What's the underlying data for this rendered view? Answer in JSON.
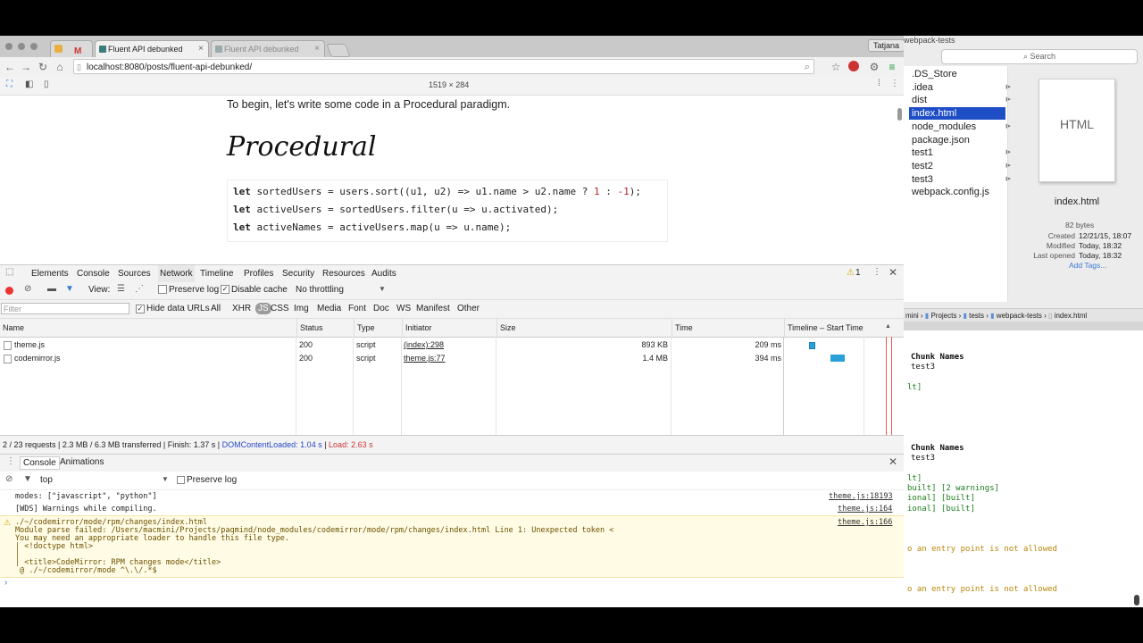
{
  "browser": {
    "tabs": [
      {
        "label": ""
      },
      {
        "label": "Fluent API debunked"
      },
      {
        "label": "Fluent API debunked"
      }
    ],
    "profile": "Tatjana",
    "url": "localhost:8080/posts/fluent-api-debunked/",
    "viewport_size": "1519 × 284"
  },
  "article": {
    "intro": "To begin, let's write some code in a Procedural paradigm.",
    "heading": "Procedural",
    "code": [
      {
        "kw": "let",
        "rest_a": " sortedUsers = users.sort((u1, u2) => u1.name > u2.name ? ",
        "n1": "1",
        "mid": " : ",
        "n2": "-1",
        "end": ");"
      },
      {
        "kw": "let",
        "rest": " activeUsers = sortedUsers.filter(u => u.activated);"
      },
      {
        "kw": "let",
        "rest": " activeNames = activeUsers.map(u => u.name);"
      }
    ]
  },
  "devtools": {
    "tabs": [
      "Elements",
      "Console",
      "Sources",
      "Network",
      "Timeline",
      "Profiles",
      "Security",
      "Resources",
      "Audits"
    ],
    "active_tab": "Network",
    "warning_count": "1",
    "network": {
      "view_label": "View:",
      "preserve_log": "Preserve log",
      "disable_cache": "Disable cache",
      "throttling": "No throttling",
      "filter_placeholder": "Filter",
      "hide_data_urls": "Hide data URLs",
      "types": [
        "All",
        "XHR",
        "JS",
        "CSS",
        "Img",
        "Media",
        "Font",
        "Doc",
        "WS",
        "Manifest",
        "Other"
      ],
      "active_type": "JS",
      "columns": [
        "Name",
        "Status",
        "Type",
        "Initiator",
        "Size",
        "Time",
        "Timeline – Start Time"
      ],
      "rows": [
        {
          "name": "theme.js",
          "status": "200",
          "type": "script",
          "initiator": "(index):298",
          "size": "893 KB",
          "time": "209 ms"
        },
        {
          "name": "codemirror.js",
          "status": "200",
          "type": "script",
          "initiator": "theme.js:77",
          "size": "1.4 MB",
          "time": "394 ms"
        }
      ],
      "summary": "2 / 23 requests | 2.3 MB / 6.3 MB transferred | Finish: 1.37 s | ",
      "domcontentloaded": "DOMContentLoaded: 1.04 s",
      "sep": " | ",
      "load": "Load: 2.63 s"
    },
    "drawer": {
      "tabs": [
        "Console",
        "Animations"
      ],
      "context": "top",
      "preserve_log": "Preserve log",
      "lines": [
        {
          "text": "modes: [\"javascript\", \"python\"]",
          "src": "theme.js:18193"
        },
        {
          "text": "[WDS] Warnings while compiling.",
          "src": "theme.js:164"
        }
      ],
      "warning": {
        "src": "theme.js:166",
        "lines": [
          "./~/codemirror/mode/rpm/changes/index.html",
          "Module parse failed: /Users/macmini/Projects/paqmind/node_modules/codemirror/mode/rpm/changes/index.html Line 1: Unexpected token <",
          "You may need an appropriate loader to handle this file type.",
          "| <!doctype html>",
          "|",
          "| <title>CodeMirror: RPM changes mode</title>",
          " @ ./~/codemirror/mode ^\\.\\/.*$"
        ]
      },
      "prompt": "›"
    }
  },
  "finder": {
    "title": "webpack-tests",
    "search_placeholder": "Search",
    "items": [
      {
        "label": ".DS_Store",
        "folder": false
      },
      {
        "label": ".idea",
        "folder": true
      },
      {
        "label": "dist",
        "folder": true
      },
      {
        "label": "index.html",
        "folder": false,
        "selected": true
      },
      {
        "label": "node_modules",
        "folder": true
      },
      {
        "label": "package.json",
        "folder": false
      },
      {
        "label": "test1",
        "folder": true
      },
      {
        "label": "test2",
        "folder": true
      },
      {
        "label": "test3",
        "folder": true
      },
      {
        "label": "webpack.config.js",
        "folder": false
      }
    ],
    "preview_label": "HTML",
    "preview_name": "index.html",
    "size": "82 bytes",
    "meta": [
      {
        "k": "Created",
        "v": "12/21/15, 18:07"
      },
      {
        "k": "Modified",
        "v": "Today, 18:32"
      },
      {
        "k": "Last opened",
        "v": "Today, 18:32"
      }
    ],
    "add_tags": "Add Tags...",
    "path": [
      "mini",
      "Projects",
      "tests",
      "webpack-tests",
      "index.html"
    ]
  },
  "terminal": {
    "lines": [
      {
        "text": "Chunk Names",
        "bold": true
      },
      {
        "text": "test3",
        "bold": false
      },
      {
        "text": "",
        "bold": false
      },
      {
        "text": "lt]",
        "bold": false,
        "color": "#1a7d1a"
      },
      {
        "text": "",
        "bold": false
      },
      {
        "text": "",
        "bold": false
      },
      {
        "text": "",
        "bold": false
      },
      {
        "text": "",
        "bold": false
      },
      {
        "text": "",
        "bold": false
      },
      {
        "text": "Chunk Names",
        "bold": true
      },
      {
        "text": "test3",
        "bold": false
      },
      {
        "text": "",
        "bold": false
      },
      {
        "text": "lt]",
        "bold": false,
        "color": "#1a7d1a"
      },
      {
        "text": "built] [2 warnings]",
        "bold": false,
        "color": "#1a7d1a"
      },
      {
        "text": "ional] [built]",
        "bold": false,
        "color": "#1a7d1a"
      },
      {
        "text": "ional] [built]",
        "bold": false,
        "color": "#1a7d1a"
      },
      {
        "text": "",
        "bold": false
      },
      {
        "text": "",
        "bold": false
      },
      {
        "text": "",
        "bold": false
      },
      {
        "text": "o an entry point is not allowed",
        "bold": false,
        "color": "#b8860b"
      },
      {
        "text": "",
        "bold": false
      },
      {
        "text": "",
        "bold": false
      },
      {
        "text": "",
        "bold": false
      },
      {
        "text": "o an entry point is not allowed",
        "bold": false,
        "color": "#b8860b"
      }
    ]
  },
  "colors": {
    "accent": "#2a6bd1",
    "finder_selection": "#1e4ec5",
    "load_red": "#c33",
    "dcl_blue": "#2a49c8",
    "record_red": "#e33",
    "warning_bg": "#fffbe5"
  }
}
